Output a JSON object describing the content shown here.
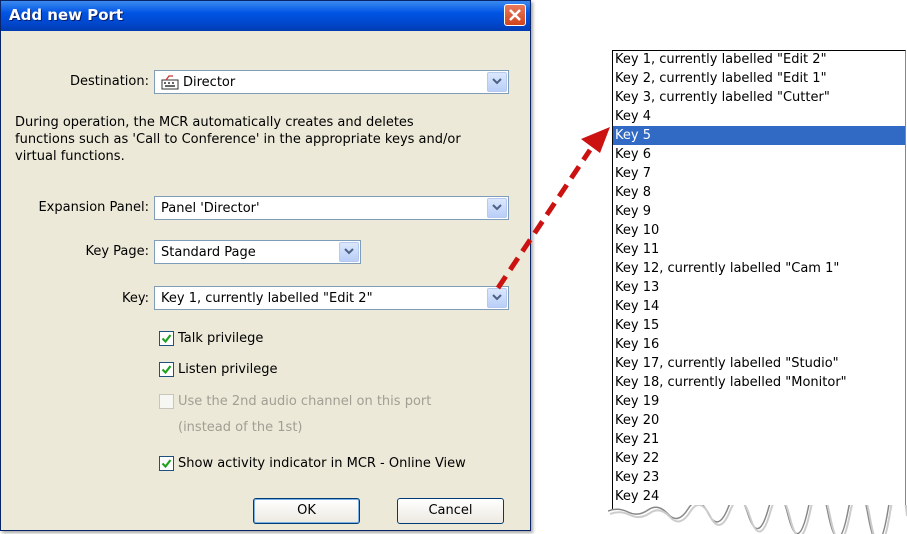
{
  "dialog": {
    "title": "Add new Port",
    "destination_label": "Destination:",
    "destination_value": "Director",
    "description": "During operation, the MCR automatically creates and deletes functions such as 'Call to Conference' in the appropriate keys and/or virtual functions.",
    "expansion_label": "Expansion Panel:",
    "expansion_value": "Panel 'Director'",
    "keypage_label": "Key Page:",
    "keypage_value": "Standard Page",
    "key_label": "Key:",
    "key_value": "Key 1, currently labelled \"Edit 2\"",
    "checks": [
      {
        "label": "Talk privilege",
        "checked": true,
        "enabled": true
      },
      {
        "label": "Listen privilege",
        "checked": true,
        "enabled": true
      },
      {
        "label": "Use the 2nd audio channel on this port",
        "label2": "(instead of the 1st)",
        "checked": false,
        "enabled": false
      },
      {
        "label": "Show activity indicator in MCR - Online View",
        "checked": true,
        "enabled": true
      }
    ],
    "ok_label": "OK",
    "cancel_label": "Cancel"
  },
  "keylist": {
    "selected_index": 4,
    "items": [
      "Key 1, currently labelled \"Edit 2\"",
      "Key 2, currently labelled \"Edit 1\"",
      "Key 3, currently labelled \"Cutter\"",
      "Key 4",
      "Key 5",
      "Key 6",
      "Key 7",
      "Key 8",
      "Key 9",
      "Key 10",
      "Key 11",
      "Key 12, currently labelled \"Cam 1\"",
      "Key 13",
      "Key 14",
      "Key 15",
      "Key 16",
      "Key 17, currently labelled \"Studio\"",
      "Key 18, currently labelled \"Monitor\"",
      "Key 19",
      "Key 20",
      "Key 21",
      "Key 22",
      "Key 23",
      "Key 24"
    ]
  },
  "colors": {
    "accent": "#0054e3",
    "selection": "#316ac5",
    "arrow": "#cc1111"
  }
}
